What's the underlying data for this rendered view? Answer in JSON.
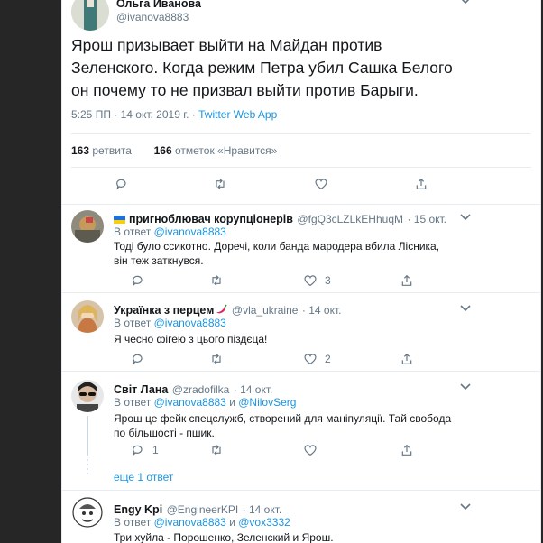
{
  "main": {
    "name": "Ольга Иванова",
    "handle": "@ivanova8883",
    "text": "Ярош призывает выйти на Майдан против Зеленского. Когда режим Петра убил Сашка Белого он почему то не призвал выйти против Барыги.",
    "time": "5:25 ПП · 14 окт. 2019 г. · ",
    "source": "Twitter Web App",
    "retweets_count": "163",
    "retweets_label": "ретвита",
    "likes_count": "166",
    "likes_label": "отметок «Нравится»"
  },
  "replies": [
    {
      "name": "пригноблювач корупціонерів",
      "handle": "@fgQ3cLZLkEHhuqM",
      "date": "· 15 окт.",
      "reply_prefix": "В ответ",
      "reply_to": "@ivanova8883",
      "text": "Тоді було ссикотно. Доречі, коли банда мародера вбила Лісника, він теж заткнувся.",
      "likes": "3"
    },
    {
      "name": "Українка з перцем",
      "handle": "@vla_ukraine",
      "date": "· 14 окт.",
      "reply_prefix": "В ответ",
      "reply_to": "@ivanova8883",
      "text": "Я чесно фігею з цього піздєца!",
      "likes": "2"
    },
    {
      "name": "Світ Лана",
      "handle": "@zradofilka",
      "date": "· 14 окт.",
      "reply_prefix": "В ответ",
      "reply_to": "@ivanova8883",
      "reply_and": "и",
      "reply_to2": "@NilovSerg",
      "text": "Ярош це фейк спецслужб, створений для маніпуляції. Тай свобода по більшості - пшик.",
      "replies": "1",
      "more": "еще 1 ответ"
    },
    {
      "name": "Engy Kpi",
      "handle": "@EngineerKPI",
      "date": "· 14 окт.",
      "reply_prefix": "В ответ",
      "reply_to": "@ivanova8883",
      "reply_and": "и",
      "reply_to2": "@vox3332",
      "text": "Три хуйла - Порошенко, Зеленский и Ярош."
    }
  ],
  "colors": {
    "link": "#1b95e0",
    "muted": "#657786",
    "divider": "#e6ecf0",
    "pepper": "#e0245e"
  }
}
